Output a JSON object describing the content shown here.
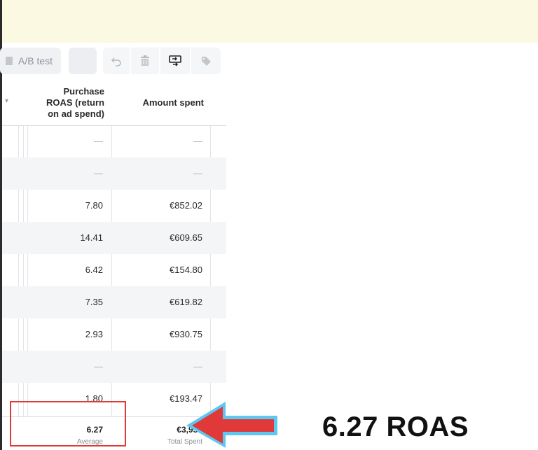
{
  "toolbar": {
    "ab_test_label": "A/B test"
  },
  "table": {
    "headers": {
      "roas": "Purchase ROAS (return on ad spend)",
      "roas_lines": [
        "Purchase",
        "ROAS (return",
        "on ad spend)"
      ],
      "amount_spent": "Amount spent"
    },
    "rows": [
      {
        "roas": "—",
        "spent": "—"
      },
      {
        "roas": "—",
        "spent": "—"
      },
      {
        "roas": "7.80",
        "spent": "€852.02"
      },
      {
        "roas": "14.41",
        "spent": "€609.65"
      },
      {
        "roas": "6.42",
        "spent": "€154.80"
      },
      {
        "roas": "7.35",
        "spent": "€619.82"
      },
      {
        "roas": "2.93",
        "spent": "€930.75"
      },
      {
        "roas": "—",
        "spent": "—"
      },
      {
        "roas": "1.80",
        "spent": "€193.47"
      }
    ],
    "totals": {
      "roas_value": "6.27",
      "roas_sub": "Average",
      "spent_value": "€3,956",
      "spent_sub": "Total Spent"
    }
  },
  "annotation": {
    "callout_text": "6.27 ROAS",
    "box_color": "#e0393a",
    "arrow_color": "#e0393a",
    "arrow_outline_color": "#5cc8f2"
  }
}
